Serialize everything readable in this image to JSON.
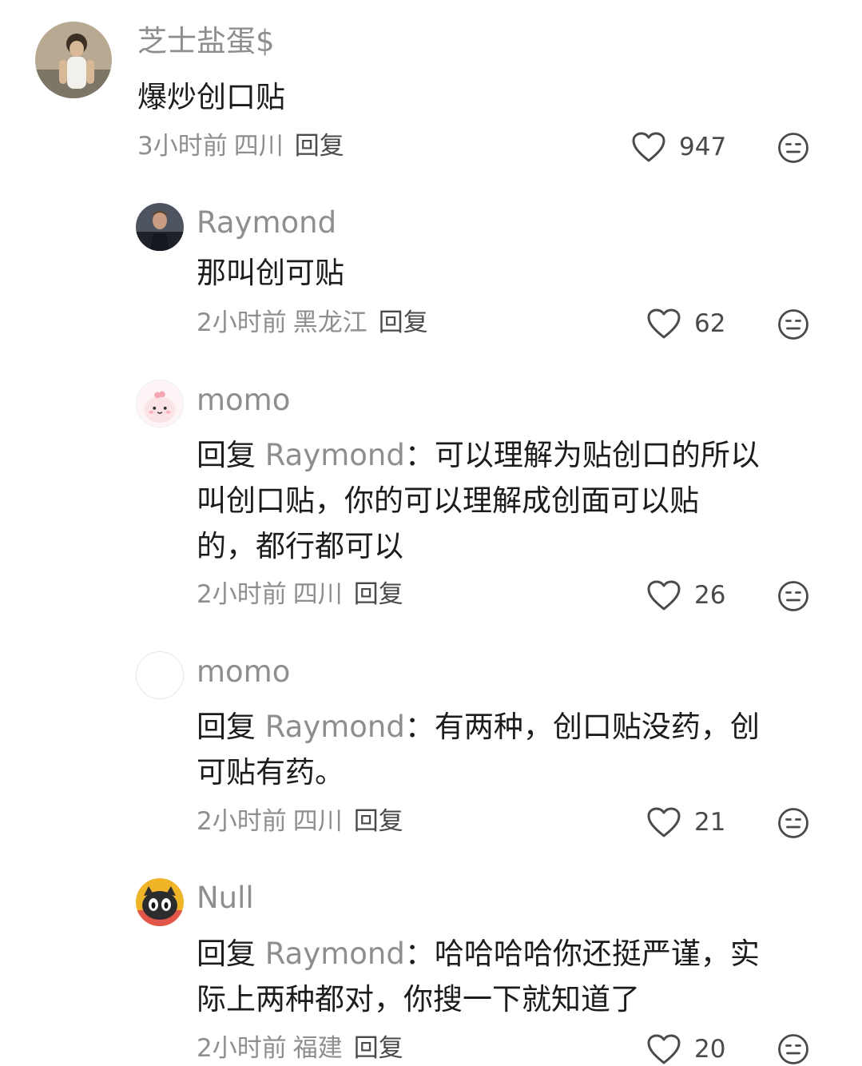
{
  "comments": [
    {
      "user": "芝士盐蛋$",
      "lines": [
        "爆炒创口贴"
      ],
      "time": "3小时前",
      "location": "四川",
      "reply_label": "回复",
      "likes": "947"
    },
    {
      "user": "Raymond",
      "lines": [
        "那叫创可贴"
      ],
      "time": "2小时前",
      "location": "黑龙江",
      "reply_label": "回复",
      "likes": "62"
    },
    {
      "user": "momo",
      "reply_prefix": "回复",
      "reply_to": "Raymond",
      "reply_colon": "：",
      "first_line": "可以理解为贴创口的所以",
      "lines": [
        "叫创口贴，你的可以理解成创面可以贴",
        "的，都行都可以"
      ],
      "time": "2小时前",
      "location": "四川",
      "reply_label": "回复",
      "likes": "26"
    },
    {
      "user": "momo",
      "reply_prefix": "回复",
      "reply_to": "Raymond",
      "reply_colon": "：",
      "first_line": "有两种，创口贴没药，创",
      "lines": [
        "可贴有药。"
      ],
      "time": "2小时前",
      "location": "四川",
      "reply_label": "回复",
      "likes": "21"
    },
    {
      "user": "Null",
      "reply_prefix": "回复",
      "reply_to": "Raymond",
      "reply_colon": "：",
      "first_line": "哈哈哈哈你还挺严谨，实",
      "lines": [
        "际上两种都对，你搜一下就知道了"
      ],
      "time": "2小时前",
      "location": "福建",
      "reply_label": "回复",
      "likes": "20"
    }
  ],
  "icons": {
    "like": "heart-outline-icon",
    "dislike": "meh-face-icon"
  },
  "colors": {
    "name": "#8e8e8e",
    "text": "#1c1c1c",
    "meta": "#8e8e8e"
  }
}
